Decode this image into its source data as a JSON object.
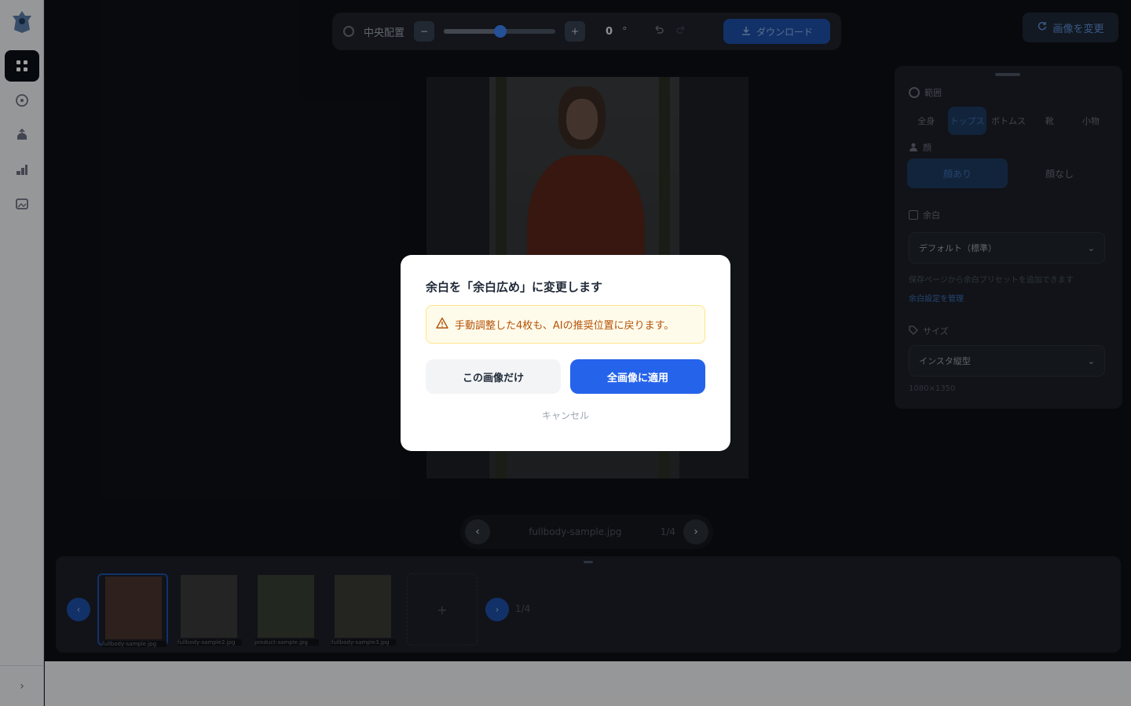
{
  "sidebar": {
    "icons": [
      "logo-icon",
      "grid-icon",
      "palette-icon",
      "upload-icon",
      "chart-icon",
      "image-icon"
    ],
    "expand_glyph": "›"
  },
  "toolbar": {
    "center_label": "中央配置",
    "minus_glyph": "−",
    "plus_glyph": "+",
    "zoom_value": "0",
    "degree_glyph": "°",
    "download_label": "ダウンロード"
  },
  "header": {
    "change_image_label": "画像を変更"
  },
  "right_panel": {
    "range_label": "範囲",
    "tabs": [
      {
        "label": "全身",
        "selected": false
      },
      {
        "label": "トップス",
        "selected": true
      },
      {
        "label": "ボトムス",
        "selected": false
      },
      {
        "label": "靴",
        "selected": false
      },
      {
        "label": "小物"
      }
    ],
    "face_label": "顔",
    "face_options": [
      {
        "label": "顔あり",
        "selected": true
      },
      {
        "label": "顔なし",
        "selected": false
      }
    ],
    "margin_label": "余白",
    "margin_select": "デフォルト（標準）",
    "margin_hint": "保存ページから余白プリセットを追加できます",
    "margin_link": "余白設定を管理",
    "size_label": "サイズ",
    "size_select": "インスタ縦型",
    "size_hint": "1080×1350"
  },
  "nav": {
    "filename": "fullbody-sample.jpg",
    "count": "1/4",
    "prev_glyph": "‹",
    "next_glyph": "›"
  },
  "thumbs": {
    "items": [
      {
        "caption": "fullbody-sample.jpg",
        "selected": true,
        "color": "#4a3530"
      },
      {
        "caption": "fullbody-sample2.jpg",
        "selected": false,
        "color": "#3a3a3a"
      },
      {
        "caption": "product-sample.jpg",
        "selected": false,
        "color": "#384034"
      },
      {
        "caption": "fullbody-sample3.jpg",
        "selected": false,
        "color": "#3b3d36"
      }
    ],
    "add_glyph": "+",
    "count": "1/4",
    "prev_glyph": "‹",
    "next_glyph": "›"
  },
  "modal": {
    "title": "余白を「余白広め」に変更します",
    "warning": "手動調整した4枚も、AIの推奨位置に戻ります。",
    "secondary_label": "この画像だけ",
    "primary_label": "全画像に適用",
    "cancel_label": "キャンセル"
  },
  "colors": {
    "primary": "#2563eb",
    "warning_bg": "#fffbeb",
    "warning_border": "#fde68a",
    "warning_text": "#b45309"
  }
}
